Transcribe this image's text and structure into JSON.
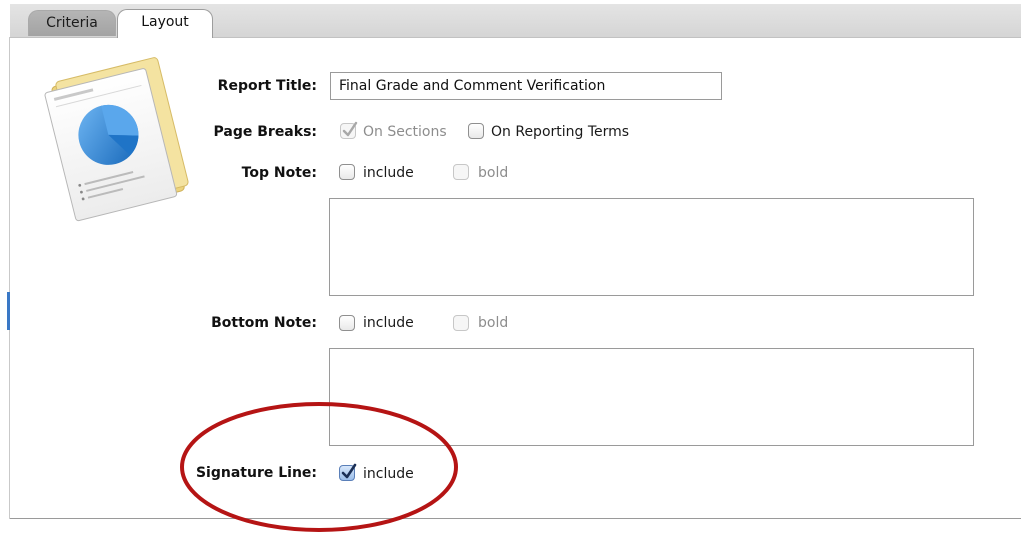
{
  "tabs": [
    {
      "label": "Criteria",
      "active": false
    },
    {
      "label": "Layout",
      "active": true
    }
  ],
  "report_title": {
    "label": "Report Title:",
    "value": "Final Grade and Comment Verification"
  },
  "page_breaks": {
    "label": "Page Breaks:",
    "on_sections": {
      "label": "On Sections",
      "checked": true,
      "enabled": false
    },
    "on_reporting_terms": {
      "label": "On Reporting Terms",
      "checked": false,
      "enabled": true
    }
  },
  "top_note": {
    "label": "Top Note:",
    "include": {
      "label": "include",
      "checked": false
    },
    "bold": {
      "label": "bold",
      "checked": false,
      "enabled": false
    },
    "text": ""
  },
  "bottom_note": {
    "label": "Bottom Note:",
    "include": {
      "label": "include",
      "checked": false
    },
    "bold": {
      "label": "bold",
      "checked": false,
      "enabled": false
    },
    "text": ""
  },
  "signature_line": {
    "label": "Signature Line:",
    "include": {
      "label": "include",
      "checked": true
    }
  },
  "icons": {
    "report": "report-document-pie-chart-icon",
    "checkmark": "checkmark-icon"
  },
  "colors": {
    "annotation": "#b51414",
    "pie": "#2f86d6",
    "paper_back": "#f2e09a",
    "checkbox_checked": "#9bbde9"
  }
}
